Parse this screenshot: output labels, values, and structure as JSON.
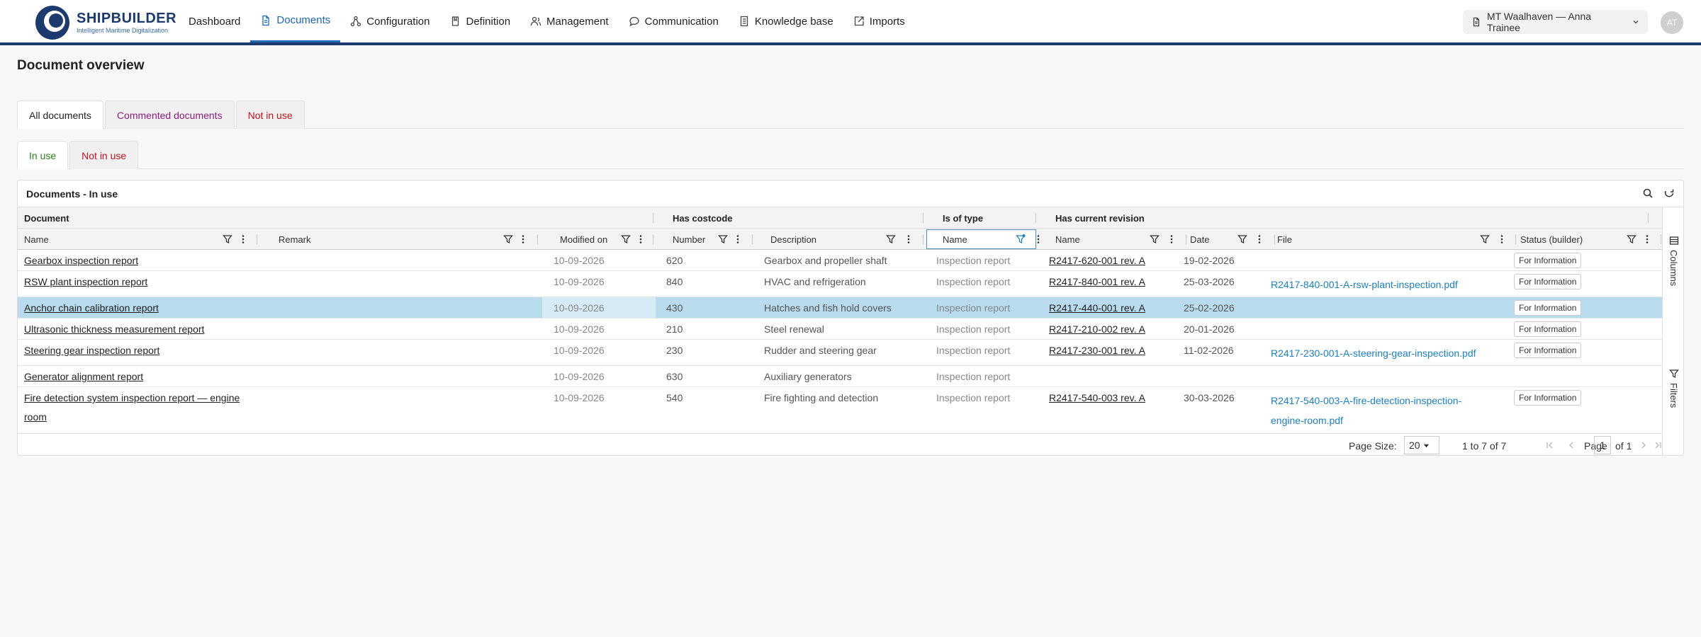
{
  "brand": {
    "name": "SHIPBUILDER",
    "tagline": "Intelligent Maritime Digitalization",
    "accent": "#1c3a6e"
  },
  "nav": {
    "items": [
      {
        "label": "Dashboard",
        "icon": ""
      },
      {
        "label": "Documents",
        "icon": "document-icon",
        "active": true
      },
      {
        "label": "Configuration",
        "icon": "network-icon"
      },
      {
        "label": "Definition",
        "icon": "book-icon"
      },
      {
        "label": "Management",
        "icon": "people-icon"
      },
      {
        "label": "Communication",
        "icon": "chat-icon"
      },
      {
        "label": "Knowledge base",
        "icon": "notebook-icon"
      },
      {
        "label": "Imports",
        "icon": "import-icon"
      }
    ]
  },
  "user": {
    "vessel": "MT Waalhaven — Anna Trainee",
    "initials": "AT"
  },
  "page": {
    "title": "Document overview"
  },
  "tabs": [
    "All documents",
    "Commented documents",
    "Not in use"
  ],
  "subtabs": [
    "In use",
    "Not in use"
  ],
  "grid": {
    "title": "Documents - In use",
    "groups": [
      "Document",
      "Has costcode",
      "Is of type",
      "Has current revision"
    ],
    "columns": [
      "Name",
      "Remark",
      "Modified on",
      "Number",
      "Description",
      "Name",
      "Name",
      "Date",
      "File",
      "Status (builder)"
    ],
    "rows": [
      {
        "name": "Gearbox inspection report",
        "modified": "10-09-2026",
        "number": "620",
        "description": "Gearbox and propeller shaft",
        "type": "Inspection report",
        "revision": "R2417-620-001 rev. A",
        "date": "19-02-2026",
        "file": "",
        "status": "For Information"
      },
      {
        "name": "RSW plant inspection report",
        "modified": "10-09-2026",
        "number": "840",
        "description": "HVAC and refrigeration",
        "type": "Inspection report",
        "revision": "R2417-840-001 rev. A",
        "date": "25-03-2026",
        "file": "R2417-840-001-A-rsw-plant-inspection.pdf",
        "status": "For Information"
      },
      {
        "name": "Anchor chain calibration report",
        "modified": "10-09-2026",
        "number": "430",
        "description": "Hatches and fish hold covers",
        "type": "Inspection report",
        "revision": "R2417-440-001 rev. A",
        "date": "25-02-2026",
        "file": "",
        "status": "For Information",
        "selected": true
      },
      {
        "name": "Ultrasonic thickness measurement report",
        "modified": "10-09-2026",
        "number": "210",
        "description": "Steel renewal",
        "type": "Inspection report",
        "revision": "R2417-210-002 rev. A",
        "date": "20-01-2026",
        "file": "",
        "status": "For Information"
      },
      {
        "name": "Steering gear inspection report",
        "modified": "10-09-2026",
        "number": "230",
        "description": "Rudder and steering gear",
        "type": "Inspection report",
        "revision": "R2417-230-001 rev. A",
        "date": "11-02-2026",
        "file": "R2417-230-001-A-steering-gear-inspection.pdf",
        "status": "For Information"
      },
      {
        "name": "Generator alignment report",
        "modified": "10-09-2026",
        "number": "630",
        "description": "Auxiliary generators",
        "type": "Inspection report",
        "revision": "",
        "date": "",
        "file": "",
        "status": ""
      },
      {
        "name": "Fire detection system inspection report — engine room",
        "name_l1": "Fire detection system inspection report — engine",
        "name_l2": "room",
        "modified": "10-09-2026",
        "number": "540",
        "description": "Fire fighting and detection",
        "type": "Inspection report",
        "revision": "R2417-540-003 rev. A",
        "date": "30-03-2026",
        "file": "R2417-540-003-A-fire-detection-inspection-engine-room.pdf",
        "file_l1": "R2417-540-003-A-fire-detection-inspection-",
        "file_l2": "engine-room.pdf",
        "status": "For Information"
      }
    ],
    "side": {
      "columns": "Columns",
      "filters": "Filters"
    },
    "pager": {
      "size_label": "Page Size:",
      "size": "20",
      "range": "1 to 7 of 7",
      "page_label": "Page",
      "page": "1",
      "of": "of 1"
    }
  }
}
